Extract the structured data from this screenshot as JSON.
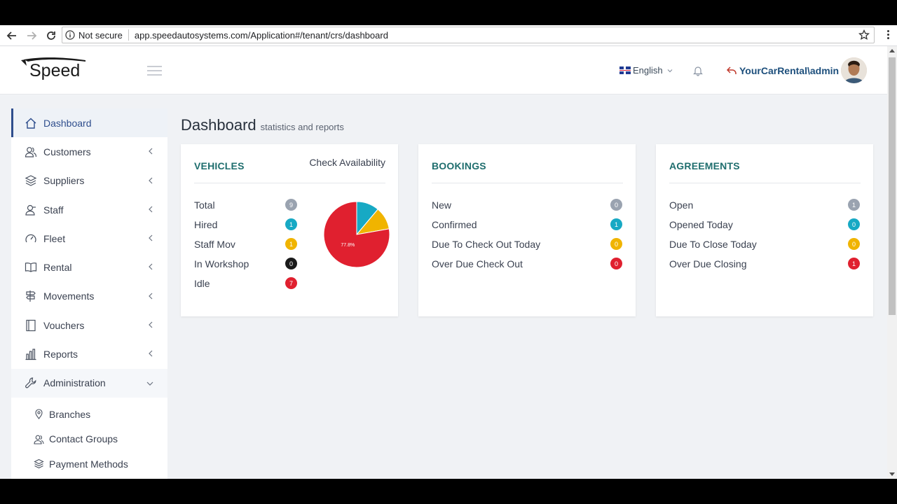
{
  "browser": {
    "security_label": "Not secure",
    "url": "app.speedautosystems.com/Application#/tenant/crs/dashboard"
  },
  "header": {
    "logo_text": "Speed",
    "language": "English",
    "user": "YourCarRental\\admin"
  },
  "sidebar": {
    "items": [
      {
        "label": "Dashboard"
      },
      {
        "label": "Customers"
      },
      {
        "label": "Suppliers"
      },
      {
        "label": "Staff"
      },
      {
        "label": "Fleet"
      },
      {
        "label": "Rental"
      },
      {
        "label": "Movements"
      },
      {
        "label": "Vouchers"
      },
      {
        "label": "Reports"
      },
      {
        "label": "Administration"
      }
    ],
    "sub_items": [
      {
        "label": "Branches"
      },
      {
        "label": "Contact Groups"
      },
      {
        "label": "Payment Methods"
      }
    ]
  },
  "page": {
    "title": "Dashboard",
    "subtitle": "statistics and reports"
  },
  "colors": {
    "grey": "#9aa3b0",
    "teal": "#17a9c4",
    "amber": "#f0b400",
    "black": "#1a1a1a",
    "red": "#e0202f"
  },
  "vehicles": {
    "title": "VEHICLES",
    "link": "Check Availability",
    "rows": [
      {
        "label": "Total",
        "count": "9",
        "color": "grey"
      },
      {
        "label": "Hired",
        "count": "1",
        "color": "teal"
      },
      {
        "label": "Staff Mov",
        "count": "1",
        "color": "amber"
      },
      {
        "label": "In Workshop",
        "count": "0",
        "color": "black"
      },
      {
        "label": "Idle",
        "count": "7",
        "color": "red"
      }
    ]
  },
  "bookings": {
    "title": "BOOKINGS",
    "rows": [
      {
        "label": "New",
        "count": "0",
        "color": "grey"
      },
      {
        "label": "Confirmed",
        "count": "1",
        "color": "teal"
      },
      {
        "label": "Due To Check Out Today",
        "count": "0",
        "color": "amber"
      },
      {
        "label": "Over Due Check Out",
        "count": "0",
        "color": "red"
      }
    ]
  },
  "agreements": {
    "title": "AGREEMENTS",
    "rows": [
      {
        "label": "Open",
        "count": "1",
        "color": "grey"
      },
      {
        "label": "Opened Today",
        "count": "0",
        "color": "teal"
      },
      {
        "label": "Due To Close Today",
        "count": "0",
        "color": "amber"
      },
      {
        "label": "Over Due Closing",
        "count": "1",
        "color": "red"
      }
    ]
  },
  "chart_data": {
    "type": "pie",
    "categories": [
      "Hired",
      "Staff Mov",
      "Idle"
    ],
    "values": [
      1,
      1,
      7
    ],
    "colors": [
      "#17a9c4",
      "#f0b400",
      "#e0202f"
    ],
    "data_labels": [
      "",
      "",
      "77.8%"
    ]
  }
}
